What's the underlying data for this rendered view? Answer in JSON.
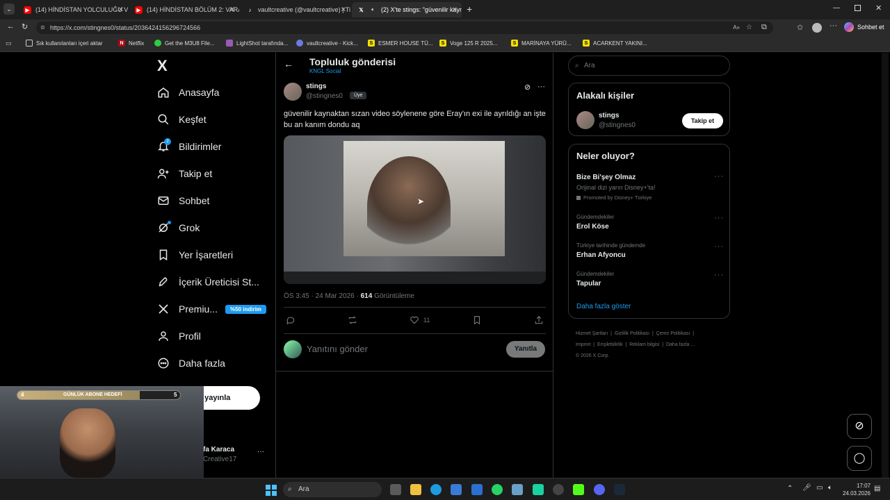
{
  "browser": {
    "tabs": [
      {
        "title": "(14) HİNDİSTAN YOLCULUĞU VE H",
        "icon": "youtube-icon"
      },
      {
        "title": "(14) HİNDİSTAN BÖLÜM 2: VARAN",
        "icon": "youtube-icon"
      },
      {
        "title": "vaultcreative (@vaultcreative) | Tik",
        "icon": "tiktok-icon"
      },
      {
        "title": "(2) X'te stings: \"güvenilir kayn",
        "icon": "x-icon"
      }
    ],
    "url": "https://x.com/stingnes0/status/2036424156296724566",
    "chat_label": "Sohbet et",
    "bookmarks": [
      "Sık kullanılanları içeri aktar",
      "Netflix",
      "Get the M3U8 File...",
      "LightShot tarafında...",
      "vaultcreative - Kick...",
      "ESMER HOUSE TÜ...",
      "Voge 125 R 2025...",
      "MARİNAYA YÜRÜ...",
      "ACARKENT YAKINI..."
    ]
  },
  "sidebar": {
    "logo": "X",
    "items": [
      {
        "label": "Anasayfa",
        "icon": "home-icon"
      },
      {
        "label": "Keşfet",
        "icon": "search-icon"
      },
      {
        "label": "Bildirimler",
        "icon": "bell-icon",
        "badge": "2"
      },
      {
        "label": "Takip et",
        "icon": "person-add-icon"
      },
      {
        "label": "Sohbet",
        "icon": "mail-icon"
      },
      {
        "label": "Grok",
        "icon": "grok-icon"
      },
      {
        "label": "Yer İşaretleri",
        "icon": "bookmark-icon"
      },
      {
        "label": "İçerik Üreticisi St...",
        "icon": "rocket-icon"
      },
      {
        "label": "Premiu...",
        "icon": "x-icon",
        "badge": "%50 indirim"
      },
      {
        "label": "Profil",
        "icon": "person-icon"
      },
      {
        "label": "Daha fazla",
        "icon": "more-circle-icon"
      }
    ],
    "post_button": "i yayınla",
    "account_name": "fa Karaca",
    "account_handle": "Creative17"
  },
  "post": {
    "header_title": "Topluluk gönderisi",
    "community": "KNGL Social",
    "author_name": "stings",
    "author_handle": "@stingnes0",
    "role_badge": "Üye",
    "text": "güvenilir kaynaktan sızan video söylenene göre Eray'ın exi ile ayrıldığı an işte bu an kanım dondu aq",
    "timestamp": "ÖS 3:45 · 24 Mar 2026 · ",
    "views": "614",
    "views_label": "Görüntüleme",
    "likes": "11",
    "reply_placeholder": "Yanıtını gönder",
    "reply_button": "Yanıtla"
  },
  "right": {
    "search_placeholder": "Ara",
    "related_title": "Alakalı kişiler",
    "related_name": "stings",
    "related_handle": "@stingnes0",
    "follow_button": "Takip et",
    "trends_title": "Neler oluyor?",
    "promo_title": "Bize Bi'şey Olmaz",
    "promo_text": "Orijinal dizi yarın Disney+'ta!",
    "promo_by": "Promoted by Disney+ Türkiye",
    "trends": [
      {
        "category": "Gündemdekiler",
        "name": "Erol Köse"
      },
      {
        "category": "Türkiye tarihinde gündemde",
        "name": "Erhan Afyoncu"
      },
      {
        "category": "Gündemdekiler",
        "name": "Tapular"
      }
    ],
    "show_more": "Daha fazla göster",
    "footer": [
      "Hizmet Şartları",
      "Gizlilik Politikası",
      "Çerez Politikası",
      "Imprint",
      "Erişilebilirlik",
      "Reklam bilgisi",
      "Daha fazla ...",
      "© 2026 X Corp."
    ]
  },
  "overlay": {
    "goal_label": "GÜNLÜK ABONE HEDEFİ",
    "goal_start": "4",
    "goal_end": "5",
    "goal_progress": 0.75
  },
  "taskbar": {
    "search": "Ara",
    "time": "17:07",
    "date": "24.03.2026"
  },
  "colors": {
    "accent": "#1d9bf0",
    "background": "#000000",
    "border": "#2f3336"
  }
}
